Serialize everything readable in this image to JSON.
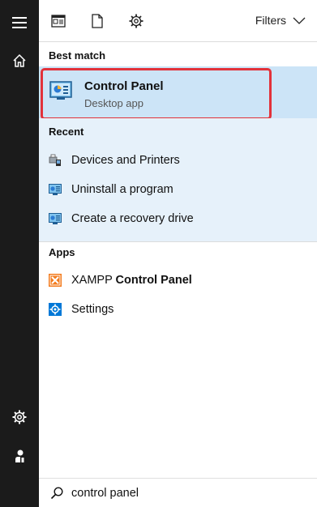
{
  "rail": {
    "icons": [
      "hamburger-menu-icon",
      "home-icon",
      "settings-gear-icon",
      "user-account-icon"
    ]
  },
  "toolbar": {
    "icons": [
      "apps-view-icon",
      "documents-icon",
      "settings-icon"
    ],
    "filters_label": "Filters"
  },
  "best_match": {
    "heading": "Best match",
    "title": "Control Panel",
    "subtitle": "Desktop app",
    "icon": "control-panel-icon"
  },
  "recent": {
    "heading": "Recent",
    "items": [
      {
        "label": "Devices and Printers",
        "icon": "devices-printers-icon"
      },
      {
        "label": "Uninstall a program",
        "icon": "control-panel-small-icon"
      },
      {
        "label": "Create a recovery drive",
        "icon": "control-panel-small-icon"
      }
    ]
  },
  "apps": {
    "heading": "Apps",
    "items": [
      {
        "label_prefix": "XAMPP ",
        "label_bold": "Control Panel",
        "icon": "xampp-icon"
      },
      {
        "label": "Settings",
        "icon": "settings-app-icon"
      }
    ]
  },
  "search": {
    "query": "control panel",
    "icon": "search-icon"
  },
  "colors": {
    "accent": "#0078d7",
    "selection": "#cce4f7",
    "highlight_border": "#e2323a",
    "rail_bg": "#1b1b1b"
  }
}
